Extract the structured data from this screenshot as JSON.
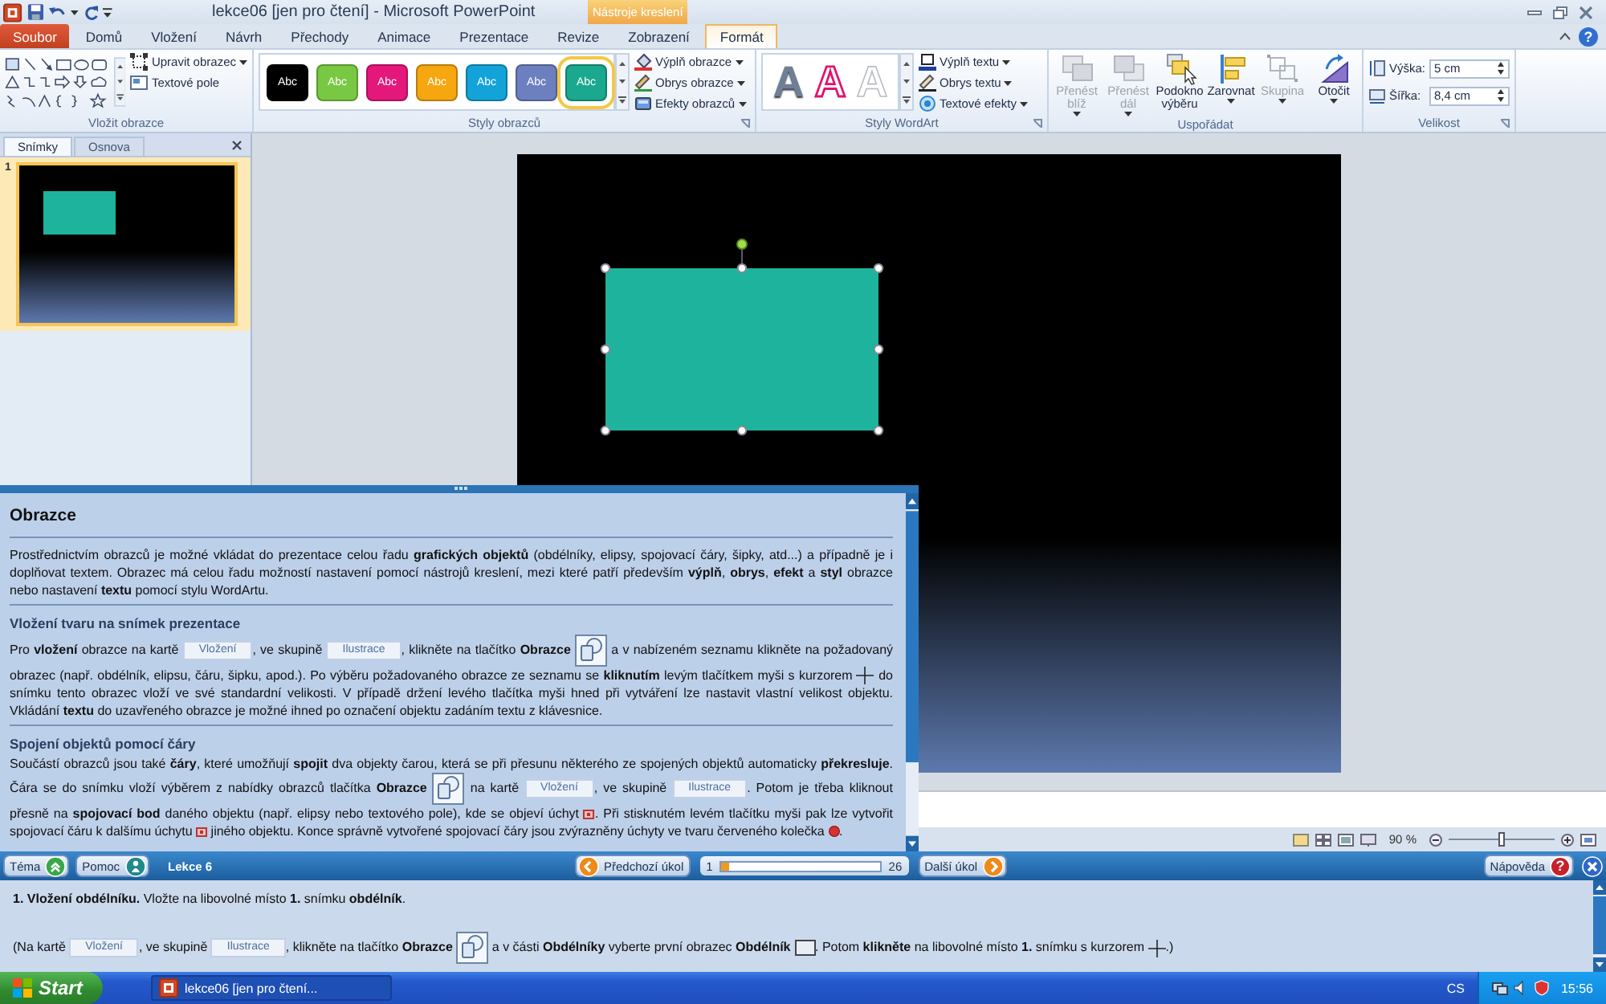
{
  "window": {
    "title": "lekce06 [jen pro čtení] - Microsoft PowerPoint",
    "context_group": "Nástroje kreslení",
    "help_glyph": "?"
  },
  "ribbon_tabs": [
    {
      "label": "Soubor",
      "kind": "file",
      "selected": false
    },
    {
      "label": "Domů",
      "kind": "normal",
      "selected": false
    },
    {
      "label": "Vložení",
      "kind": "normal",
      "selected": false
    },
    {
      "label": "Návrh",
      "kind": "normal",
      "selected": false
    },
    {
      "label": "Přechody",
      "kind": "normal",
      "selected": false
    },
    {
      "label": "Animace",
      "kind": "normal",
      "selected": false
    },
    {
      "label": "Prezentace",
      "kind": "normal",
      "selected": false
    },
    {
      "label": "Revize",
      "kind": "normal",
      "selected": false
    },
    {
      "label": "Zobrazení",
      "kind": "normal",
      "selected": false
    },
    {
      "label": "Formát",
      "kind": "contextual",
      "selected": true
    }
  ],
  "insert_shapes": {
    "label": "Vložit obrazce",
    "commands": [
      {
        "label": "Upravit obrazec",
        "kind": "edit-shape",
        "menu": true
      },
      {
        "label": "Textové pole",
        "kind": "text-box",
        "menu": false
      }
    ]
  },
  "shape_styles": {
    "label": "Styly obrazců",
    "swatches": [
      {
        "text": "Abc",
        "color": "#000000",
        "selected": false
      },
      {
        "text": "Abc",
        "color": "#79c843",
        "selected": false
      },
      {
        "text": "Abc",
        "color": "#e4177b",
        "selected": false
      },
      {
        "text": "Abc",
        "color": "#f6a60f",
        "selected": false
      },
      {
        "text": "Abc",
        "color": "#13a3d8",
        "selected": false
      },
      {
        "text": "Abc",
        "color": "#6c80c0",
        "selected": false
      },
      {
        "text": "Abc",
        "color": "#1aa88f",
        "selected": true
      }
    ],
    "commands": [
      {
        "label": "Výplň obrazce",
        "kind": "fill",
        "menu": true
      },
      {
        "label": "Obrys obrazce",
        "kind": "outline",
        "menu": true
      },
      {
        "label": "Efekty obrazců",
        "kind": "effects",
        "menu": true
      }
    ]
  },
  "wordart_styles": {
    "label": "Styly WordArt",
    "samples": [
      {
        "text": "A",
        "kind": "gradient"
      },
      {
        "text": "A",
        "kind": "outline"
      },
      {
        "text": "A",
        "kind": "faint"
      }
    ],
    "commands": [
      {
        "label": "Výplň textu",
        "kind": "text-fill",
        "menu": true
      },
      {
        "label": "Obrys textu",
        "kind": "text-outline",
        "menu": true
      },
      {
        "label": "Textové efekty",
        "kind": "text-effects",
        "menu": true
      }
    ]
  },
  "arrange": {
    "label": "Uspořádat",
    "commands": [
      {
        "label": "Přenést blíž",
        "kind": "bring-forward",
        "menu": true,
        "disabled": true
      },
      {
        "label": "Přenést dál",
        "kind": "send-backward",
        "menu": true,
        "disabled": true
      },
      {
        "label": "Podokno výběru",
        "kind": "selection-pane",
        "menu": false,
        "disabled": false
      },
      {
        "label": "Zarovnat",
        "kind": "align",
        "menu": true,
        "disabled": false
      },
      {
        "label": "Skupina",
        "kind": "group",
        "menu": true,
        "disabled": true
      },
      {
        "label": "Otočit",
        "kind": "rotate",
        "menu": true,
        "disabled": false
      }
    ]
  },
  "size": {
    "label": "Velikost",
    "fields": [
      {
        "label": "Výška:",
        "value": "5 cm",
        "kind": "height"
      },
      {
        "label": "Šířka:",
        "value": "8,4 cm",
        "kind": "width"
      }
    ]
  },
  "slides_panel": {
    "tabs": [
      {
        "label": "Snímky",
        "selected": true
      },
      {
        "label": "Osnova",
        "selected": false
      }
    ],
    "slides": [
      {
        "number": "1",
        "selected": true
      }
    ]
  },
  "slide": {
    "shape_selected": true
  },
  "status_bar": {
    "zoom": "90 %",
    "zoom_slider": {
      "level": 0.5
    }
  },
  "help_panel": {
    "title": "Obrazce",
    "sections": [
      {
        "paragraphs": [
          [
            {
              "kind": "text",
              "text": "Prostřednictvím obrazců je možné vkládat do prezentace celou řadu **grafických objektů** (obdélníky, elipsy, spojovací čáry, šipky, atd...) a případně je i doplňovat textem. Obrazec má celou řadu možností nastavení pomocí nástrojů kreslení, mezi které patří především **výplň**, **obrys**, **efekt** a **styl** obrazce nebo nastavení **textu** pomocí stylu WordArtu."
            }
          ]
        ]
      },
      {
        "heading": "Vložení tvaru na snímek prezentace",
        "paragraphs": [
          [
            {
              "kind": "text",
              "text": "Pro **vložení** obrazce na kartě "
            },
            {
              "kind": "chip",
              "text": "Vložení"
            },
            {
              "kind": "text",
              "text": ", ve skupině "
            },
            {
              "kind": "chip",
              "text": "Ilustrace"
            },
            {
              "kind": "text",
              "text": ", klikněte na tlačítko **Obrazce** "
            },
            {
              "kind": "shapes-button"
            },
            {
              "kind": "text",
              "text": " a v nabízeném seznamu klikněte na požadovaný obrazec (např. obdélník, elipsu, čáru, šipku, apod.). Po výběru požadovaného obrazce ze seznamu se **kliknutím** levým tlačítkem myši s kurzorem "
            },
            {
              "kind": "crosshair"
            },
            {
              "kind": "text",
              "text": " do snímku tento obrazec vloží ve své standardní velikosti. V případě držení levého tlačítka myši hned při vytváření lze nastavit vlastní velikost objektu. Vkládání **textu** do uzavřeného obrazce je možné ihned po označení objektu zadáním textu z klávesnice."
            }
          ]
        ]
      },
      {
        "heading": "Spojení objektů pomocí čáry",
        "paragraphs": [
          [
            {
              "kind": "text",
              "text": "Součástí obrazců jsou také **čáry**, které umožňují **spojit** dva objekty čarou, která se při přesunu některého ze spojených objektů automaticky **překresluje**. Čára se do snímku vloží výběrem z nabídky obrazců tlačítka **Obrazce** "
            },
            {
              "kind": "shapes-button"
            },
            {
              "kind": "text",
              "text": " na kartě "
            },
            {
              "kind": "chip",
              "text": "Vložení"
            },
            {
              "kind": "text",
              "text": ", ve skupině "
            },
            {
              "kind": "chip",
              "text": "Ilustrace"
            },
            {
              "kind": "text",
              "text": ". Potom je třeba kliknout přesně na **spojovací bod** daného objektu (např. elipsy nebo textového pole), kde se objeví úchyt "
            },
            {
              "kind": "handle"
            },
            {
              "kind": "text",
              "text": ". Při stisknutém levém tlačítku myši pak lze vytvořit spojovací čáru k dalšímu úchytu "
            },
            {
              "kind": "handle"
            },
            {
              "kind": "text",
              "text": " jiného objektu. Konce správně vytvořené spojovací čáry jsou zvýrazněny úchyty ve tvaru červeného kolečka "
            },
            {
              "kind": "red-dot"
            },
            {
              "kind": "text",
              "text": "."
            }
          ]
        ]
      }
    ]
  },
  "lesson_bar": {
    "buttons": [
      {
        "label": "Téma",
        "kind": "topic"
      },
      {
        "label": "Pomoc",
        "kind": "help"
      }
    ],
    "title": "Lekce 6",
    "previous": "Předchozí úkol",
    "progress": {
      "start": "1",
      "end": "26",
      "level": 0.05
    },
    "next": "Další úkol",
    "help": {
      "label": "Nápověda",
      "glyph": "?"
    }
  },
  "task_panel": {
    "paragraphs": [
      [
        {
          "kind": "text",
          "text": "**1. Vložení obdélníku.** Vložte na libovolné místo **1.** snímku **obdélník**."
        }
      ],
      [
        {
          "kind": "text",
          "text": "(Na kartě "
        },
        {
          "kind": "chip",
          "text": "Vložení"
        },
        {
          "kind": "text",
          "text": ", ve skupině "
        },
        {
          "kind": "chip",
          "text": "Ilustrace"
        },
        {
          "kind": "text",
          "text": ", klikněte na tlačítko **Obrazce** "
        },
        {
          "kind": "shapes-button"
        },
        {
          "kind": "text",
          "text": " a v části **Obdélníky** vyberte první obrazec **Obdélník** "
        },
        {
          "kind": "rectangle"
        },
        {
          "kind": "text",
          "text": ". Potom **klikněte** na libovolné místo **1.** snímku s kurzorem "
        },
        {
          "kind": "crosshair"
        },
        {
          "kind": "text",
          "text": ".)"
        }
      ]
    ]
  },
  "taskbar": {
    "start": "Start",
    "windows": [
      {
        "label": "lekce06 [jen pro čtení...",
        "selected": true
      }
    ],
    "language": "CS",
    "time": "15:56"
  }
}
